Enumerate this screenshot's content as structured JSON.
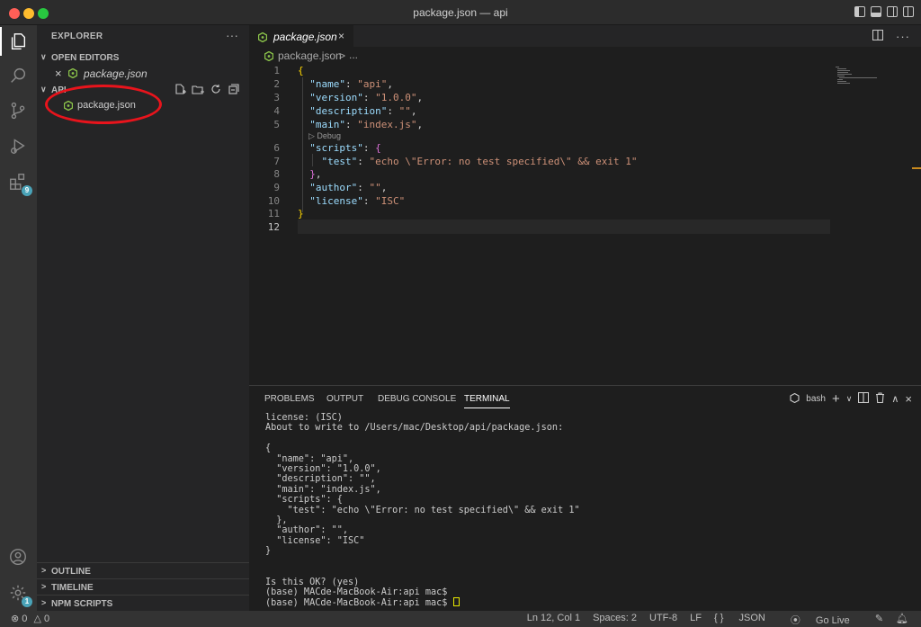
{
  "window": {
    "title": "package.json — api"
  },
  "activity_bar": {
    "extensions_badge": "9",
    "settings_badge": "1"
  },
  "sidebar": {
    "title": "EXPLORER",
    "more": "···",
    "open_editors": {
      "label": "OPEN EDITORS",
      "items": [
        {
          "close": "×",
          "name": "package.json"
        }
      ]
    },
    "folder": {
      "label": "API",
      "files": [
        {
          "name": "package.json"
        }
      ]
    },
    "bottom_sections": [
      {
        "label": "OUTLINE"
      },
      {
        "label": "TIMELINE"
      },
      {
        "label": "NPM SCRIPTS"
      }
    ]
  },
  "editor": {
    "tab": {
      "name": "package.json",
      "close": "×"
    },
    "breadcrumb": {
      "file": "package.json",
      "sep": ">",
      "more": "..."
    },
    "line_numbers": [
      "1",
      "2",
      "3",
      "4",
      "5",
      "6",
      "7",
      "8",
      "9",
      "10",
      "11",
      "12"
    ],
    "codelens": "▷ Debug",
    "code": {
      "open_brace": "{",
      "name_key": "\"name\"",
      "name_val": "\"api\"",
      "version_key": "\"version\"",
      "version_val": "\"1.0.0\"",
      "description_key": "\"description\"",
      "description_val": "\"\"",
      "main_key": "\"main\"",
      "main_val": "\"index.js\"",
      "scripts_key": "\"scripts\"",
      "scripts_open": "{",
      "test_key": "\"test\"",
      "test_val": "\"echo \\\"Error: no test specified\\\" && exit 1\"",
      "scripts_close": "}",
      "author_key": "\"author\"",
      "author_val": "\"\"",
      "license_key": "\"license\"",
      "license_val": "\"ISC\"",
      "close_brace": "}"
    }
  },
  "panel": {
    "tabs": [
      "PROBLEMS",
      "OUTPUT",
      "DEBUG CONSOLE",
      "TERMINAL"
    ],
    "active_tab": "TERMINAL",
    "shell": "bash",
    "terminal_lines": [
      "license: (ISC)",
      "About to write to /Users/mac/Desktop/api/package.json:",
      "",
      "{",
      "  \"name\": \"api\",",
      "  \"version\": \"1.0.0\",",
      "  \"description\": \"\",",
      "  \"main\": \"index.js\",",
      "  \"scripts\": {",
      "    \"test\": \"echo \\\"Error: no test specified\\\" && exit 1\"",
      "  },",
      "  \"author\": \"\",",
      "  \"license\": \"ISC\"",
      "}",
      "",
      "",
      "Is this OK? (yes)",
      "(base) MACde-MacBook-Air:api mac$",
      "(base) MACde-MacBook-Air:api mac$ "
    ]
  },
  "status_bar": {
    "errors": "0",
    "warnings": "0",
    "position": "Ln 12, Col 1",
    "spaces": "Spaces: 2",
    "encoding": "UTF-8",
    "eol": "LF",
    "language": "JSON",
    "go_live": "Go Live"
  },
  "colors": {
    "annotation_ellipse": "#e8141c",
    "json_icon": "#8bc34a",
    "string": "#ce9178",
    "key": "#9cdcfe"
  }
}
